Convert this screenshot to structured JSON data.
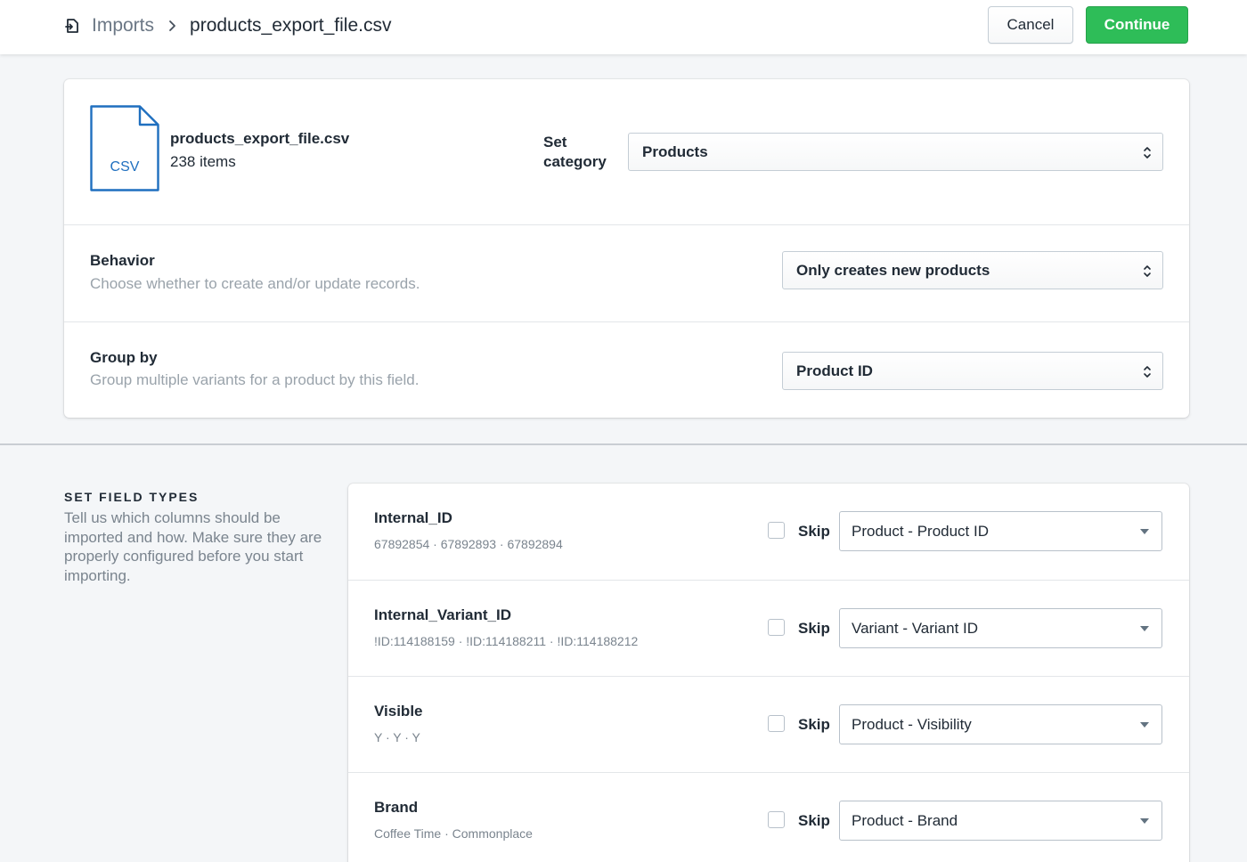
{
  "header": {
    "breadcrumb_parent": "Imports",
    "breadcrumb_current": "products_export_file.csv",
    "cancel_label": "Cancel",
    "continue_label": "Continue"
  },
  "file": {
    "type_label": "CSV",
    "name": "products_export_file.csv",
    "item_count": "238 items"
  },
  "settings": {
    "category": {
      "label": "Set category",
      "value": "Products"
    },
    "behavior": {
      "title": "Behavior",
      "help": "Choose whether to create and/or update records.",
      "value": "Only creates new products"
    },
    "group_by": {
      "title": "Group by",
      "help": "Group multiple variants for a product by this field.",
      "value": "Product ID"
    }
  },
  "field_types": {
    "heading": "SET FIELD TYPES",
    "description": "Tell us which columns should be imported and how. Make sure they are properly configured before you start importing.",
    "skip_label": "Skip",
    "rows": [
      {
        "name": "Internal_ID",
        "sample": "67892854 · 67892893 · 67892894",
        "skip": false,
        "type": "Product - Product ID"
      },
      {
        "name": "Internal_Variant_ID",
        "sample": "!ID:114188159 · !ID:114188211 · !ID:114188212",
        "skip": false,
        "type": "Variant - Variant ID"
      },
      {
        "name": "Visible",
        "sample": "Y · Y · Y",
        "skip": false,
        "type": "Product - Visibility"
      },
      {
        "name": "Brand",
        "sample": "Coffee Time · Commonplace",
        "skip": false,
        "type": "Product - Brand"
      }
    ]
  },
  "colors": {
    "accent_green": "#2ebd58",
    "csv_blue": "#1f6fbf",
    "page_bg": "#f4f6f8"
  }
}
